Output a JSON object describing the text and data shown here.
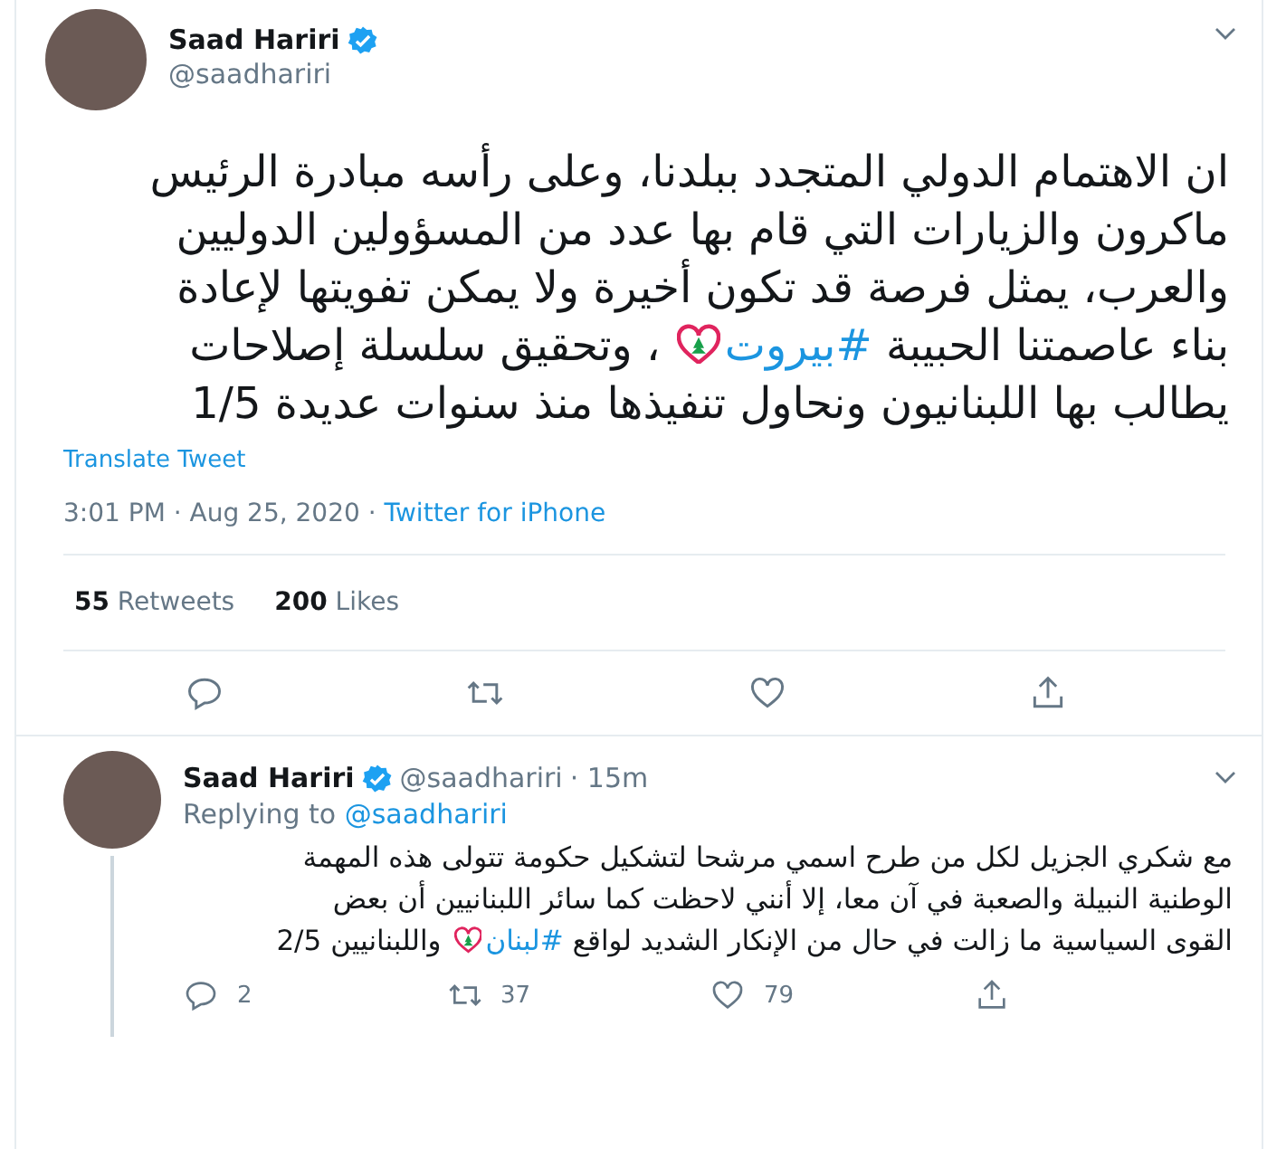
{
  "tweet": {
    "author": {
      "name": "Saad Hariri",
      "handle": "@saadhariri",
      "verified": true
    },
    "lines": [
      [
        {
          "kind": "text",
          "text": "ان الاهتمام الدولي المتجدد ببلدنا، وعلى رأسه مبادرة الرئيس"
        }
      ],
      [
        {
          "kind": "text",
          "text": "ماكرون والزيارات التي قام بها عدد من المسؤولين الدوليين"
        }
      ],
      [
        {
          "kind": "text",
          "text": "والعرب، يمثل فرصة قد تكون أخيرة ولا يمكن تفويتها لإعادة"
        }
      ],
      [
        {
          "kind": "text",
          "text": "بناء عاصمتنا الحبيبة "
        },
        {
          "kind": "hashtag",
          "text": "#بيروت"
        },
        {
          "kind": "flag-heart"
        },
        {
          "kind": "text",
          "text": " ، وتحقيق سلسلة إصلاحات"
        }
      ],
      [
        {
          "kind": "text",
          "text": "يطالب بها اللبنانيون ونحاول تنفيذها منذ سنوات عديدة 1/5"
        }
      ]
    ],
    "translate": "Translate Tweet",
    "time": "3:01 PM · Aug 25, 2020 · ",
    "source": "Twitter for iPhone",
    "retweets": {
      "count": "55",
      "label": "Retweets"
    },
    "likes": {
      "count": "200",
      "label": "Likes"
    }
  },
  "reply": {
    "author": {
      "name": "Saad Hariri",
      "handle": "@saadhariri",
      "verified": true
    },
    "age": "· 15m",
    "replying_label": "Replying to",
    "replying_to": "@saadhariri",
    "lines": [
      [
        {
          "kind": "text",
          "text": "مع شكري الجزيل لكل من طرح اسمي مرشحا لتشكيل حكومة تتولى هذه المهمة"
        }
      ],
      [
        {
          "kind": "text",
          "text": "الوطنية النبيلة والصعبة في آن معا، إلا أنني لاحظت كما سائر اللبنانيين أن بعض"
        }
      ],
      [
        {
          "kind": "text",
          "text": "القوى السياسية ما زالت في حال من الإنكار الشديد لواقع "
        },
        {
          "kind": "hashtag",
          "text": "#لبنان"
        },
        {
          "kind": "flag-heart"
        },
        {
          "kind": "text",
          "text": " واللبنانيين 2/5"
        }
      ]
    ],
    "replies": "2",
    "retweets": "37",
    "likes": "79"
  }
}
